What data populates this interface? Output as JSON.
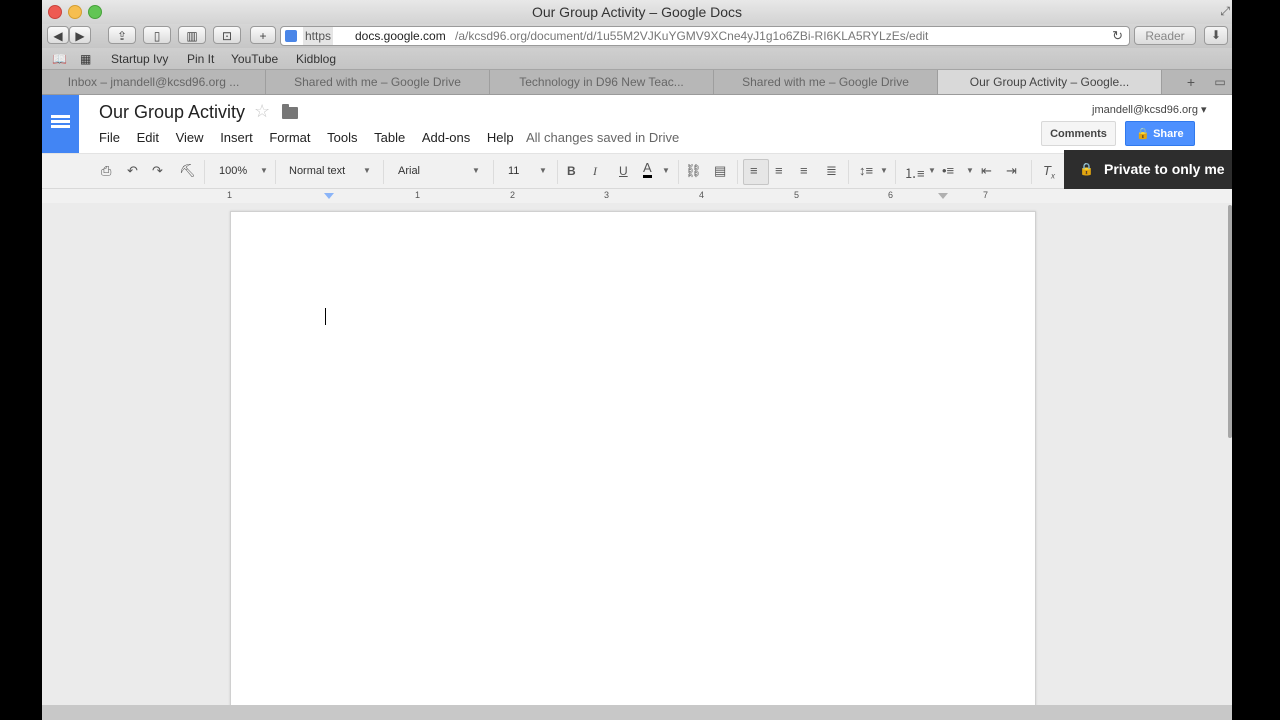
{
  "window": {
    "title": "Our Group Activity – Google Docs"
  },
  "browser": {
    "url_https": "https",
    "url_host": "docs.google.com",
    "url_path": "/a/kcsd96.org/document/d/1u55M2VJKuYGMV9XCne4yJ1g1o6ZBi-RI6KLA5RYLzEs/edit",
    "reader_label": "Reader",
    "bookmarks": [
      "Startup Ivy",
      "Pin It",
      "YouTube",
      "Kidblog"
    ],
    "tabs": [
      {
        "label": "Inbox – jmandell@kcsd96.org ..."
      },
      {
        "label": "Shared with me – Google Drive"
      },
      {
        "label": "Technology in D96 New Teac..."
      },
      {
        "label": "Shared with me – Google Drive"
      },
      {
        "label": "Our Group Activity – Google..."
      }
    ],
    "active_tab_index": 4
  },
  "docs": {
    "title": "Our Group Activity",
    "menus": [
      "File",
      "Edit",
      "View",
      "Insert",
      "Format",
      "Tools",
      "Table",
      "Add-ons",
      "Help"
    ],
    "save_status": "All changes saved in Drive",
    "account": "jmandell@kcsd96.org",
    "comments_label": "Comments",
    "share_label": "Share",
    "share_tooltip": "Private to only me",
    "accent_color": "#4d90fe",
    "toolbar": {
      "zoom": "100%",
      "style": "Normal text",
      "font": "Arial",
      "font_size": "11",
      "bold_glyph": "B",
      "italic_glyph": "I",
      "underline_glyph": "U",
      "text_color_glyph": "A"
    },
    "ruler_numbers": [
      "1",
      "1",
      "2",
      "3",
      "4",
      "5",
      "6",
      "7"
    ]
  }
}
